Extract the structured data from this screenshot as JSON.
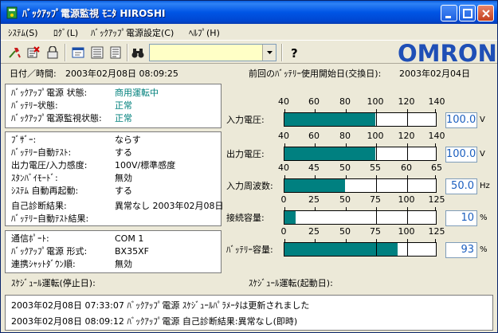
{
  "window": {
    "title": "ﾊﾞｯｸｱｯﾌﾟ電源監視 ﾓﾆﾀ HIROSHI",
    "colors": {
      "titlebar": "#0055e5",
      "accent_teal": "#00807c",
      "bar_fill": "#008080",
      "value_blue": "#1c5fbf",
      "logo_blue": "#1f4fb6"
    }
  },
  "menu": [
    {
      "label": "ｼｽﾃﾑ(S)"
    },
    {
      "label": "ﾛｸﾞ(L)"
    },
    {
      "label": "ﾊﾞｯｸｱｯﾌﾟ電源設定(C)"
    },
    {
      "label": "ﾍﾙﾌﾟ(H)"
    }
  ],
  "toolbar": {
    "icons": [
      "connect-icon",
      "stop-monitor-icon",
      "lock-icon",
      "window-icon",
      "list-icon",
      "document-icon",
      "binoculars-icon",
      "help-icon"
    ],
    "combo_value": "",
    "logo": "OMRON"
  },
  "info": {
    "datetime_label": "日付／時間:",
    "datetime_value": "2003年02月08日 08:09:25",
    "battery_change_label": "前回のﾊﾞｯﾃﾘｰ使用開始日(交換日):",
    "battery_change_value": "2003年02月04日"
  },
  "status_panel": [
    {
      "label": "ﾊﾞｯｸｱｯﾌﾟ電源 状態:",
      "value": "商用運転中"
    },
    {
      "label": "ﾊﾞｯﾃﾘｰ状態:",
      "value": "正常"
    },
    {
      "label": "ﾊﾞｯｸｱｯﾌﾟ電源監視状態:",
      "value": "正常"
    }
  ],
  "settings_panel": [
    {
      "label": "ﾌﾞｻﾞｰ:",
      "value": "ならす"
    },
    {
      "label": "ﾊﾞｯﾃﾘｰ自動ﾃｽﾄ:",
      "value": "する"
    },
    {
      "label": "出力電圧/入力感度:",
      "value": "100V/標準感度"
    },
    {
      "label": "ｽﾀﾝﾊﾞｲﾓｰﾄﾞ:",
      "value": "無効"
    },
    {
      "label": "ｼｽﾃﾑ 自動再起動:",
      "value": "する"
    },
    {
      "label": "自己診断結果:",
      "value": "異常なし 2003年02月08日"
    },
    {
      "label": "ﾊﾞｯﾃﾘｰ自動ﾃｽﾄ結果:",
      "value": ""
    }
  ],
  "comm_panel": [
    {
      "label": "通信ﾎﾟｰﾄ:",
      "value": "COM 1"
    },
    {
      "label": "ﾊﾞｯｸｱｯﾌﾟ電源 形式:",
      "value": "BX35XF"
    },
    {
      "label": "連携ｼｬｯﾄﾀﾞｳﾝ順:",
      "value": "無効"
    }
  ],
  "gauges": [
    {
      "label": "入力電圧:",
      "scale": [
        "40",
        "60",
        "80",
        "100",
        "120",
        "140"
      ],
      "min": 40,
      "max": 140,
      "value": 100,
      "display": "100.0",
      "unit": "V",
      "marks": [
        100,
        120
      ]
    },
    {
      "label": "出力電圧:",
      "scale": [
        "40",
        "60",
        "80",
        "100",
        "120",
        "140"
      ],
      "min": 40,
      "max": 140,
      "value": 100,
      "display": "100.0",
      "unit": "V",
      "marks": [
        100,
        120
      ]
    },
    {
      "label": "入力周波数:",
      "scale": [
        "40",
        "45",
        "50",
        "55",
        "60",
        "65"
      ],
      "min": 40,
      "max": 65,
      "value": 50,
      "display": "50.0",
      "unit": "Hz",
      "marks": [
        55,
        60
      ]
    },
    {
      "label": "接続容量:",
      "scale": [
        "0",
        "25",
        "50",
        "75",
        "100",
        "125"
      ],
      "min": 0,
      "max": 125,
      "value": 10,
      "display": "10",
      "unit": "%",
      "marks": [
        75,
        100
      ]
    },
    {
      "label": "ﾊﾞｯﾃﾘｰ容量:",
      "scale": [
        "0",
        "25",
        "50",
        "75",
        "100",
        "125"
      ],
      "min": 0,
      "max": 125,
      "value": 93,
      "display": "93",
      "unit": "%",
      "marks": [
        75,
        100
      ]
    }
  ],
  "schedule": {
    "stop_label": "ｽｹｼﾞｭｰﾙ運転(停止日):",
    "start_label": "ｽｹｼﾞｭｰﾙ運転(起動日):"
  },
  "log": [
    "2003年02月08日 07:33:07 ﾊﾞｯｸｱｯﾌﾟ電源 ｽｹｼﾞｭｰﾙﾊﾟﾗﾒｰﾀは更新されました",
    "2003年02月08日 08:09:12 ﾊﾞｯｸｱｯﾌﾟ電源 自己診断結果:異常なし(即時)"
  ]
}
